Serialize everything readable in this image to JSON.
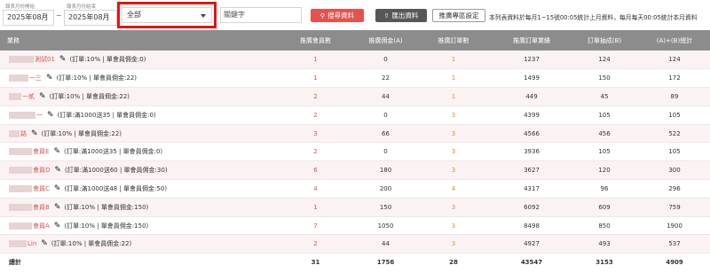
{
  "filters": {
    "start_label": "報表月份開始",
    "start_value": "2025年08月",
    "range_separator": "~",
    "end_label": "報表月份結束",
    "end_value": "2025年08月",
    "member_select_value": "全部",
    "keyword_placeholder": "關鍵字"
  },
  "buttons": {
    "search": "搜尋資料",
    "export": "匯出資料",
    "settings": "推廣專區設定"
  },
  "note": "本列表資料於每月1~15號00:05統計上月資料，每月每天00:05統計本月資料",
  "table": {
    "headers": [
      "業務",
      "推廣會員數",
      "推廣佣金(A)",
      "推廣訂單數",
      "推廣訂單業績",
      "訂單抽成(B)",
      "(A)+(B)總計"
    ],
    "rows": [
      {
        "member": "測試01",
        "plan": "(訂單:10% | 單會員佣金:0)",
        "members": "1",
        "commission": "0",
        "orders": "1",
        "sales": "1237",
        "cut": "124",
        "total": "124"
      },
      {
        "member": "一三",
        "plan": "(訂單:10% | 單會員佣金:22)",
        "members": "1",
        "commission": "22",
        "orders": "1",
        "sales": "1499",
        "cut": "150",
        "total": "172"
      },
      {
        "member": "一貳",
        "plan": "(訂單:10% | 單會員佣金:22)",
        "members": "2",
        "commission": "44",
        "orders": "1",
        "sales": "449",
        "cut": "45",
        "total": "89"
      },
      {
        "member": "一",
        "plan": "(訂單:滿1000送35 | 單會員佣金:0)",
        "members": "2",
        "commission": "0",
        "orders": "3",
        "sales": "4399",
        "cut": "105",
        "total": "105"
      },
      {
        "member": "路",
        "plan": "(訂單:10% | 單會員佣金:22)",
        "members": "3",
        "commission": "66",
        "orders": "3",
        "sales": "4566",
        "cut": "456",
        "total": "522"
      },
      {
        "member": "會員E",
        "plan": "(訂單:滿1000送35 | 單會員佣金:0)",
        "members": "2",
        "commission": "0",
        "orders": "3",
        "sales": "3936",
        "cut": "105",
        "total": "105"
      },
      {
        "member": "會員D",
        "plan": "(訂單:滿1000送60 | 單會員佣金:30)",
        "members": "6",
        "commission": "180",
        "orders": "3",
        "sales": "3627",
        "cut": "120",
        "total": "300"
      },
      {
        "member": "會員C",
        "plan": "(訂單:滿1000送48 | 單會員佣金:50)",
        "members": "4",
        "commission": "200",
        "orders": "4",
        "sales": "4317",
        "cut": "96",
        "total": "296"
      },
      {
        "member": "會員B",
        "plan": "(訂單:10% | 單會員佣金:150)",
        "members": "1",
        "commission": "150",
        "orders": "3",
        "sales": "6092",
        "cut": "609",
        "total": "759"
      },
      {
        "member": "會員A",
        "plan": "(訂單:10% | 單會員佣金:150)",
        "members": "7",
        "commission": "1050",
        "orders": "3",
        "sales": "8498",
        "cut": "850",
        "total": "1900"
      },
      {
        "member": "Lin",
        "plan": "(訂單:10% | 單會員佣金:22)",
        "members": "2",
        "commission": "44",
        "orders": "3",
        "sales": "4927",
        "cut": "493",
        "total": "537"
      }
    ],
    "totals": {
      "label": "總計",
      "members": "31",
      "commission": "1756",
      "orders": "28",
      "sales": "43547",
      "cut": "3153",
      "total": "4909"
    }
  },
  "colors": {
    "header_bg": "#8c8c8c",
    "search_button": "#e4524f",
    "export_button": "#575757",
    "highlight_box": "#e11515",
    "member_link": "#d9534f"
  },
  "icons": {
    "search": "search-icon",
    "export": "upload-icon",
    "edit": "pencil-icon",
    "dropdown": "caret-down-icon"
  }
}
